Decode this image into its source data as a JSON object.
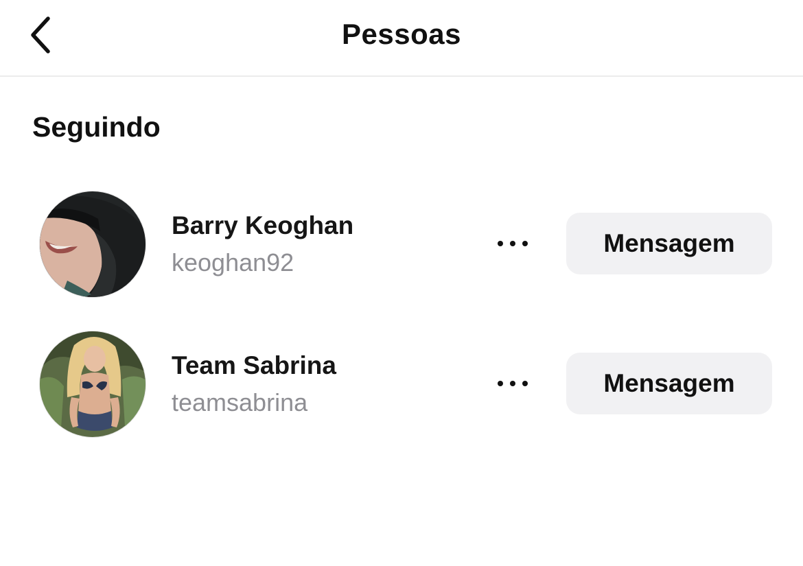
{
  "header": {
    "title": "Pessoas",
    "back_icon": "chevron-left-icon"
  },
  "section": {
    "title": "Seguindo"
  },
  "people": [
    {
      "name": "Barry Keoghan",
      "username": "keoghan92",
      "more_icon": "more-horizontal-icon",
      "button_label": "Mensagem"
    },
    {
      "name": "Team Sabrina",
      "username": "teamsabrina",
      "more_icon": "more-horizontal-icon",
      "button_label": "Mensagem"
    }
  ],
  "colors": {
    "background": "#ffffff",
    "text_primary": "#111111",
    "text_secondary": "#8e8e93",
    "button_background": "#f1f1f3",
    "divider": "#ececec"
  }
}
